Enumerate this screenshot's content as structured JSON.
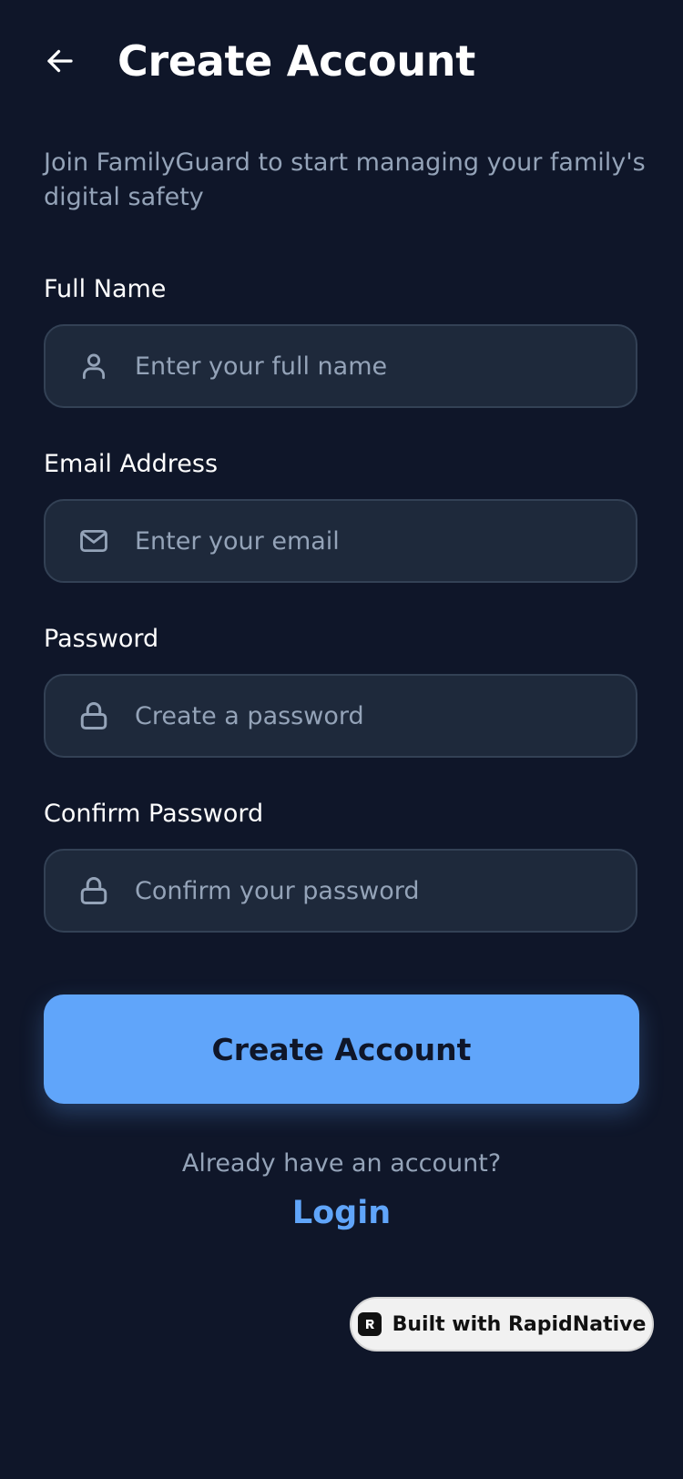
{
  "header": {
    "title": "Create Account",
    "back_icon": "arrow-left-icon"
  },
  "subtitle": "Join FamilyGuard to start managing your family's digital safety",
  "form": {
    "full_name": {
      "label": "Full Name",
      "placeholder": "Enter your full name",
      "value": "",
      "icon": "user-icon"
    },
    "email": {
      "label": "Email Address",
      "placeholder": "Enter your email",
      "value": "",
      "icon": "mail-icon"
    },
    "password": {
      "label": "Password",
      "placeholder": "Create a password",
      "value": "",
      "icon": "lock-icon"
    },
    "confirm_password": {
      "label": "Confirm Password",
      "placeholder": "Confirm your password",
      "value": "",
      "icon": "lock-icon"
    }
  },
  "actions": {
    "create_account_label": "Create Account",
    "already_text": "Already have an account?",
    "login_label": "Login"
  },
  "badge": {
    "label": "Built with RapidNative",
    "icon": "rapidnative-logo-icon"
  },
  "colors": {
    "background": "#0f1629",
    "field_background": "#1e293b",
    "field_border": "#334155",
    "accent": "#60a5fa",
    "muted_text": "#94a3b8"
  }
}
